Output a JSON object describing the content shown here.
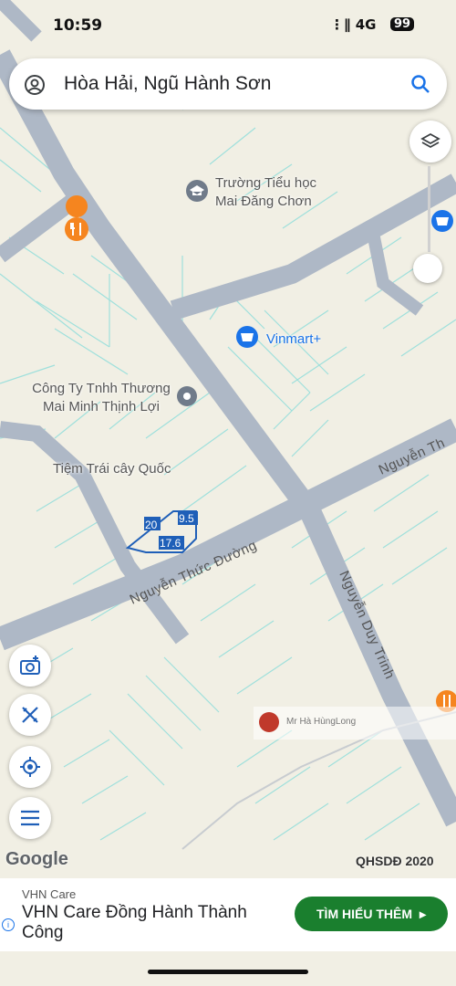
{
  "status_bar": {
    "time": "10:59",
    "signal": "⋮∥ 4G",
    "battery": "99"
  },
  "search": {
    "query": "Hòa Hải, Ngũ Hành Sơn"
  },
  "map": {
    "pois": [
      {
        "name": "Trường Tiểu học\nMai Đăng Chơn",
        "type": "school"
      },
      {
        "name": "Vinmart+",
        "type": "store"
      },
      {
        "name": "Công Ty Tnhh Thương\nMai Minh Thịnh Lợi",
        "type": "place"
      },
      {
        "name": "Tiệm Trái cây Quốc",
        "type": "place"
      }
    ],
    "roads": [
      "Nguyễn Thức Đường",
      "Nguyễn Duy Trinh",
      "Nguyễn Th"
    ],
    "lot_dimensions": [
      "20",
      "9.5",
      "17.6"
    ],
    "watermark": "Mr Hà HùngLong",
    "attribution": "Google",
    "layer_label": "QHSDĐ 2020",
    "colors": {
      "land": "#f1efe4",
      "road": "#aeb8c6",
      "parcel": "#9fe0dc",
      "poi_store": "#1a73e8",
      "poi_food": "#f5851f"
    }
  },
  "ad": {
    "source": "VHN Care",
    "headline": "VHN Care Đồng Hành Thành Công",
    "cta": "TÌM HIỂU THÊM"
  }
}
